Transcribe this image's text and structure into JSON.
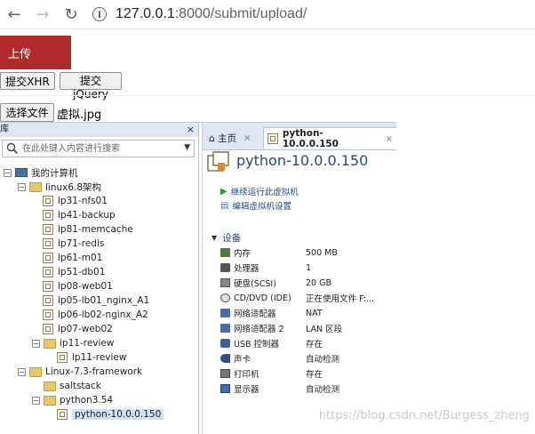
{
  "browser": {
    "url_host": "127.0.0.1",
    "url_path": ":8000/submit/upload/"
  },
  "page": {
    "upload_label": "上传",
    "submit_xhr_label": "提交XHR",
    "submit_jquery_label": "提交jQuery",
    "choose_file_label": "选择文件",
    "file_name": "虚拟.jpg"
  },
  "library": {
    "title": "库",
    "close": "×",
    "search_placeholder": "在此处键入内容进行搜索",
    "tree": {
      "root": "我的计算机",
      "linux68": "linux6.8架构",
      "ip31": "ip31-nfs01",
      "ip41": "ip41-backup",
      "ip81": "ip81-memcache",
      "ip71": "ip71-redis",
      "ip61": "ip61-m01",
      "ip51": "ip51-db01",
      "ip08": "ip08-web01",
      "ip05": "ip05-lb01_nginx_A1",
      "ip06": "ip06-lb02-nginx_A2",
      "ip07": "ip07-web02",
      "ip11folder": "ip11-review",
      "ip11vm": "ip11-review",
      "linux73": "Linux-7.3-framework",
      "saltstack": "saltstack",
      "python354": "python3.54",
      "pythonvm": "python-10.0.0.150"
    }
  },
  "vm": {
    "tab_home": "主页",
    "tab_vm": "python-10.0.0.150",
    "title": "python-10.0.0.150",
    "action_run": "继续运行此虚拟机",
    "action_edit": "编辑虚拟机设置",
    "section_devices": "设备",
    "devices": {
      "memory": {
        "name": "内存",
        "value": "500 MB"
      },
      "cpu": {
        "name": "处理器",
        "value": "1"
      },
      "disk": {
        "name": "硬盘(SCSI)",
        "value": "20 GB"
      },
      "cdrom": {
        "name": "CD/DVD (IDE)",
        "value": "正在使用文件 F:..."
      },
      "net1": {
        "name": "网络适配器",
        "value": "NAT"
      },
      "net2": {
        "name": "网络适配器 2",
        "value": "LAN 区段"
      },
      "usb": {
        "name": "USB 控制器",
        "value": "存在"
      },
      "sound": {
        "name": "声卡",
        "value": "自动检测"
      },
      "printer": {
        "name": "打印机",
        "value": "存在"
      },
      "display": {
        "name": "显示器",
        "value": "自动检测"
      }
    }
  },
  "watermark": "https://blog.csdn.net/Burgess_zheng"
}
